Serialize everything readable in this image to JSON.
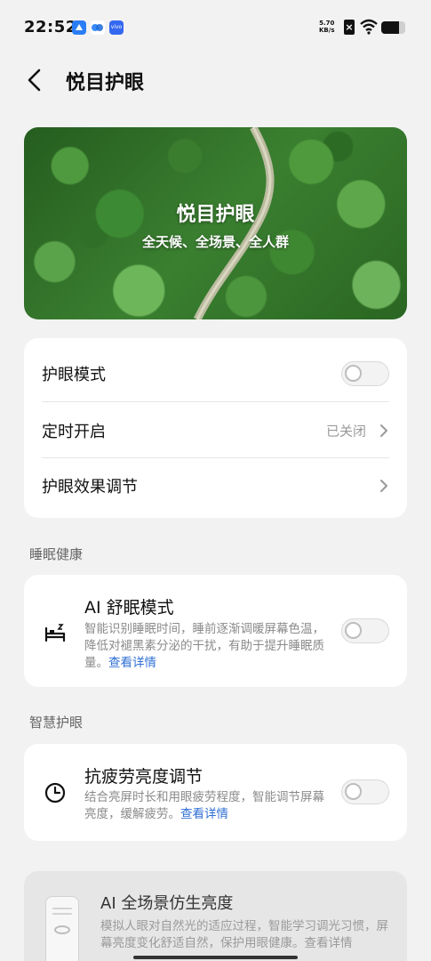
{
  "status_bar": {
    "time": "22:52",
    "net_speed_value": "5.70",
    "net_speed_unit": "KB/s",
    "app3_label": "vivo",
    "battery_level": 0.75
  },
  "header": {
    "title": "悦目护眼"
  },
  "banner": {
    "title": "悦目护眼",
    "subtitle": "全天候、全场景、全人群"
  },
  "settings": {
    "eye_mode_label": "护眼模式",
    "eye_mode_on": false,
    "schedule_label": "定时开启",
    "schedule_value": "已关闭",
    "effect_label": "护眼效果调节"
  },
  "sleep_section": {
    "heading": "睡眠健康",
    "title": "AI 舒眠模式",
    "desc": "智能识别睡眠时间，睡前逐渐调暖屏幕色温，降低对褪黑素分泌的干扰，有助于提升睡眠质量。",
    "link": "查看详情",
    "enabled": false
  },
  "smart_section": {
    "heading": "智慧护眼",
    "title": "抗疲劳亮度调节",
    "desc": "结合亮屏时长和用眼疲劳程度，智能调节屏幕亮度，缓解疲劳。",
    "link": "查看详情",
    "enabled": false
  },
  "bionic": {
    "title": "AI 全场景仿生亮度",
    "desc": "模拟人眼对自然光的适应过程，智能学习调光习惯，屏幕亮度变化舒适自然，保护用眼健康。查看详情"
  },
  "colors": {
    "link": "#2f6fd6",
    "card_bg": "#ffffff",
    "page_bg": "#f2f2f2"
  }
}
